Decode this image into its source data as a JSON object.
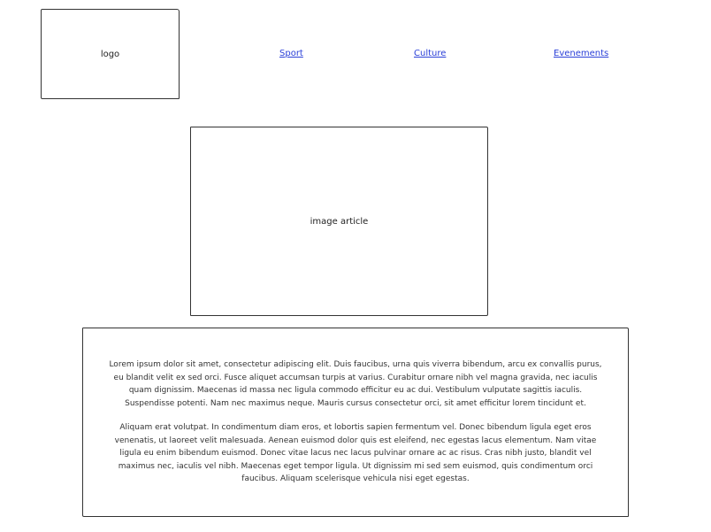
{
  "header": {
    "logo_label": "logo",
    "nav": [
      {
        "label": "Sport"
      },
      {
        "label": "Culture"
      },
      {
        "label": "Evenements"
      }
    ]
  },
  "article": {
    "image_label": "image article",
    "paragraphs": [
      "Lorem ipsum dolor sit amet, consectetur adipiscing elit. Duis faucibus, urna quis viverra bibendum, arcu ex convallis purus, eu blandit velit ex sed orci. Fusce aliquet accumsan turpis at varius. Curabitur ornare nibh vel magna gravida, nec iaculis quam dignissim. Maecenas id massa nec ligula commodo efficitur eu ac dui. Vestibulum vulputate sagittis iaculis. Suspendisse potenti. Nam nec maximus neque. Mauris cursus consectetur orci, sit amet efficitur lorem tincidunt et.",
      "Aliquam erat volutpat. In condimentum diam eros, et lobortis sapien fermentum vel. Donec bibendum ligula eget eros venenatis, ut laoreet velit malesuada. Aenean euismod dolor quis est eleifend, nec egestas lacus elementum. Nam vitae ligula eu enim bibendum euismod. Donec vitae lacus nec lacus pulvinar ornare ac ac risus. Cras nibh justo, blandit vel maximus nec, iaculis vel nibh. Maecenas eget tempor ligula. Ut dignissim mi sed sem euismod, quis condimentum orci faucibus. Aliquam scelerisque vehicula nisi eget egestas."
    ]
  },
  "colors": {
    "link": "#2b40d8",
    "border": "#333333"
  }
}
